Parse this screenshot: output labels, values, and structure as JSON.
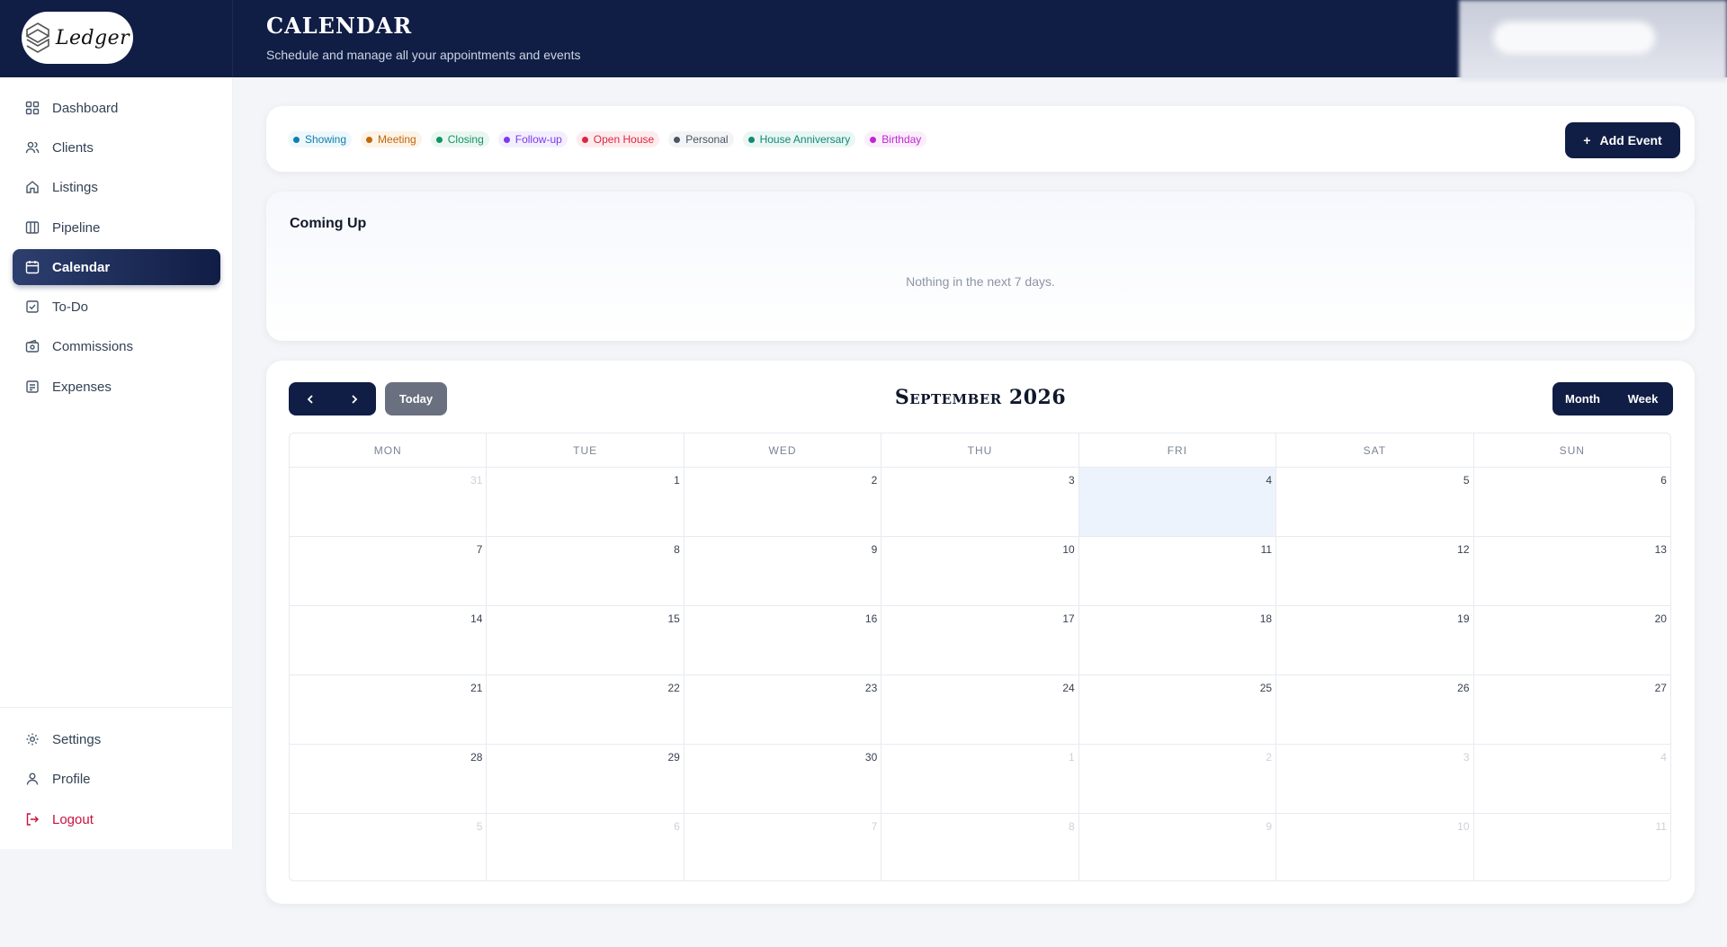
{
  "brand": {
    "logo_text": "Ledger"
  },
  "header": {
    "title": "CALENDAR",
    "subtitle": "Schedule and manage all your appointments and events"
  },
  "sidebar": {
    "items": [
      {
        "label": "Dashboard",
        "icon": "grid-icon"
      },
      {
        "label": "Clients",
        "icon": "users-icon"
      },
      {
        "label": "Listings",
        "icon": "home-icon"
      },
      {
        "label": "Pipeline",
        "icon": "columns-icon"
      },
      {
        "label": "Calendar",
        "icon": "calendar-icon",
        "active": true
      },
      {
        "label": "To-Do",
        "icon": "checkbox-icon"
      },
      {
        "label": "Commissions",
        "icon": "wallet-icon"
      },
      {
        "label": "Expenses",
        "icon": "receipt-icon"
      }
    ],
    "bottom_items": [
      {
        "label": "Settings",
        "icon": "gear-icon"
      },
      {
        "label": "Profile",
        "icon": "user-icon"
      },
      {
        "label": "Logout",
        "icon": "logout-icon"
      }
    ]
  },
  "legend": [
    {
      "label": "Showing",
      "color": "#0e7fb0",
      "bg": "#eef7fb"
    },
    {
      "label": "Meeting",
      "color": "#c2660c",
      "bg": "#fdf3e6"
    },
    {
      "label": "Closing",
      "color": "#13936a",
      "bg": "#eaf7f1"
    },
    {
      "label": "Follow-up",
      "color": "#7c3aed",
      "bg": "#f3efff"
    },
    {
      "label": "Open House",
      "color": "#dc2640",
      "bg": "#fdecee"
    },
    {
      "label": "Personal",
      "color": "#4b5563",
      "bg": "#f3f4f6"
    },
    {
      "label": "House Anniversary",
      "color": "#0f8a77",
      "bg": "#e9f6f3"
    },
    {
      "label": "Birthday",
      "color": "#c026d3",
      "bg": "#fbeefc"
    }
  ],
  "add_event_label": "Add Event",
  "upcoming": {
    "title": "Coming Up",
    "empty_text": "Nothing in the next 7 days."
  },
  "calendar": {
    "today_label": "Today",
    "month_title": "September 2026",
    "view_options": [
      "Month",
      "Week"
    ],
    "days_of_week": [
      "MON",
      "TUE",
      "WED",
      "THU",
      "FRI",
      "SAT",
      "SUN"
    ],
    "weeks": [
      [
        {
          "d": "31",
          "m": true
        },
        {
          "d": "1"
        },
        {
          "d": "2"
        },
        {
          "d": "3"
        },
        {
          "d": "4",
          "today": true
        },
        {
          "d": "5"
        },
        {
          "d": "6"
        }
      ],
      [
        {
          "d": "7"
        },
        {
          "d": "8"
        },
        {
          "d": "9"
        },
        {
          "d": "10"
        },
        {
          "d": "11"
        },
        {
          "d": "12"
        },
        {
          "d": "13"
        }
      ],
      [
        {
          "d": "14"
        },
        {
          "d": "15"
        },
        {
          "d": "16"
        },
        {
          "d": "17"
        },
        {
          "d": "18"
        },
        {
          "d": "19"
        },
        {
          "d": "20"
        }
      ],
      [
        {
          "d": "21"
        },
        {
          "d": "22"
        },
        {
          "d": "23"
        },
        {
          "d": "24"
        },
        {
          "d": "25"
        },
        {
          "d": "26"
        },
        {
          "d": "27"
        }
      ],
      [
        {
          "d": "28"
        },
        {
          "d": "29"
        },
        {
          "d": "30"
        },
        {
          "d": "1",
          "m": true
        },
        {
          "d": "2",
          "m": true
        },
        {
          "d": "3",
          "m": true
        },
        {
          "d": "4",
          "m": true
        }
      ],
      [
        {
          "d": "5",
          "m": true
        },
        {
          "d": "6",
          "m": true
        },
        {
          "d": "7",
          "m": true
        },
        {
          "d": "8",
          "m": true
        },
        {
          "d": "9",
          "m": true
        },
        {
          "d": "10",
          "m": true
        },
        {
          "d": "11",
          "m": true
        }
      ]
    ]
  }
}
